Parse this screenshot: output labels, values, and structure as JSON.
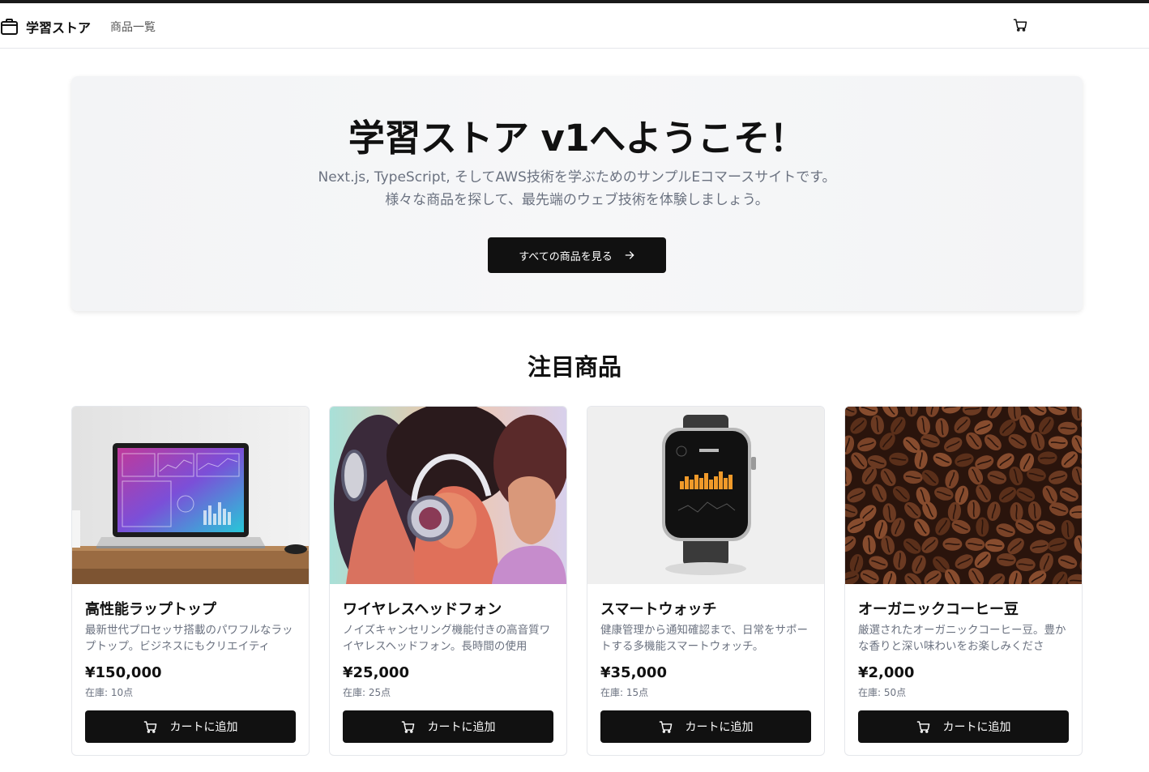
{
  "header": {
    "logo_text": "学習ストア",
    "nav_products": "商品一覧"
  },
  "hero": {
    "title": "学習ストア v1へようこそ！",
    "subtitle_line1": "Next.js, TypeScript, そしてAWS技術を学ぶためのサンプルEコマースサイトです。",
    "subtitle_line2": "様々な商品を探して、最先端のウェブ技術を体験しましょう。",
    "cta_label": "すべての商品を見る"
  },
  "featured": {
    "title": "注目商品",
    "products": [
      {
        "name": "高性能ラップトップ",
        "desc": "最新世代プロセッサ搭載のパワフルなラップトップ。ビジネスにもクリエイティ",
        "price": "¥150,000",
        "stock": "在庫: 10点",
        "button": "カートに追加",
        "image": "laptop"
      },
      {
        "name": "ワイヤレスヘッドフォン",
        "desc": "ノイズキャンセリング機能付きの高音質ワイヤレスヘッドフォン。長時間の使用",
        "price": "¥25,000",
        "stock": "在庫: 25点",
        "button": "カートに追加",
        "image": "headphones"
      },
      {
        "name": "スマートウォッチ",
        "desc": "健康管理から通知確認まで、日常をサポートする多機能スマートウォッチ。",
        "price": "¥35,000",
        "stock": "在庫: 15点",
        "button": "カートに追加",
        "image": "smartwatch"
      },
      {
        "name": "オーガニックコーヒー豆",
        "desc": "厳選されたオーガニックコーヒー豆。豊かな香りと深い味わいをお楽しみくださ",
        "price": "¥2,000",
        "stock": "在庫: 50点",
        "button": "カートに追加",
        "image": "coffee-beans"
      }
    ]
  },
  "icons": {
    "logo": "shopping-bag-icon",
    "cart": "cart-icon",
    "arrow": "arrow-right-icon"
  },
  "colors": {
    "primary": "#111111",
    "muted_text": "#6b7280",
    "hero_bg": "#f3f4f6"
  }
}
